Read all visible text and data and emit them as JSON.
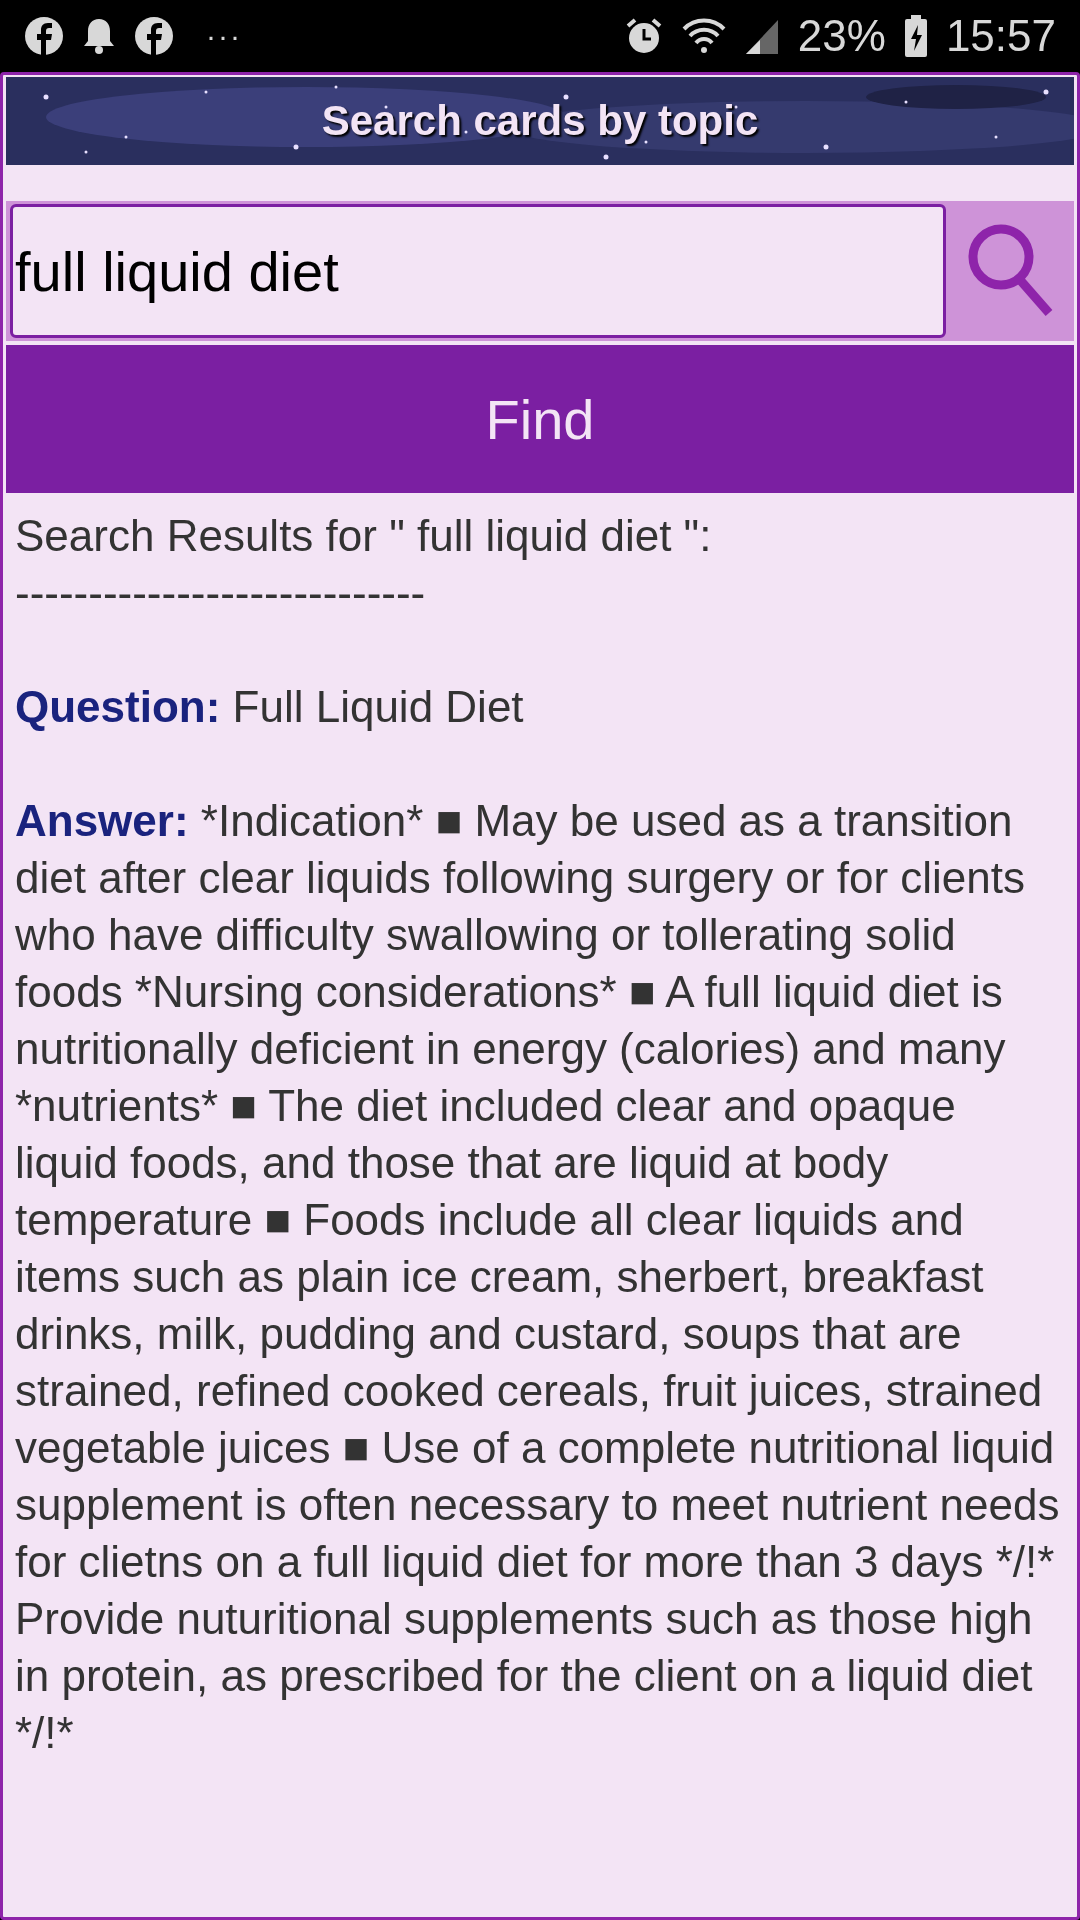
{
  "status_bar": {
    "more": "···",
    "battery": "23%",
    "time": "15:57"
  },
  "header": {
    "title": "Search cards by topic"
  },
  "search": {
    "value": "full liquid diet"
  },
  "find_button": {
    "label": "Find"
  },
  "results": {
    "heading": "Search Results for \" full liquid diet \":",
    "divider": "----------------------------",
    "question_label": "Question:",
    "question": "Full Liquid Diet",
    "answer_label": "Answer:",
    "answer": "*Indication* ■ May be used as a transition diet after clear liquids following surgery or for clients who have difficulty swallowing or tollerating solid foods *Nursing considerations* ■ A full liquid diet is nutritionally deficient in energy (calories) and many *nutrients* ■ The diet included clear and opaque liquid foods, and those that are liquid at body temperature ■ Foods include all clear liquids and items such as plain ice cream, sherbert, breakfast drinks, milk, pudding and custard, soups that are strained, refined cooked cereals, fruit juices, strained vegetable juices ■ Use of a complete nutritional liquid supplement is often necessary to meet nutrient needs for clietns on a full liquid diet for more than 3 days */!* Provide nuturitional supplements such as those high in protein, as prescribed for the client on a liquid diet */!*"
  }
}
